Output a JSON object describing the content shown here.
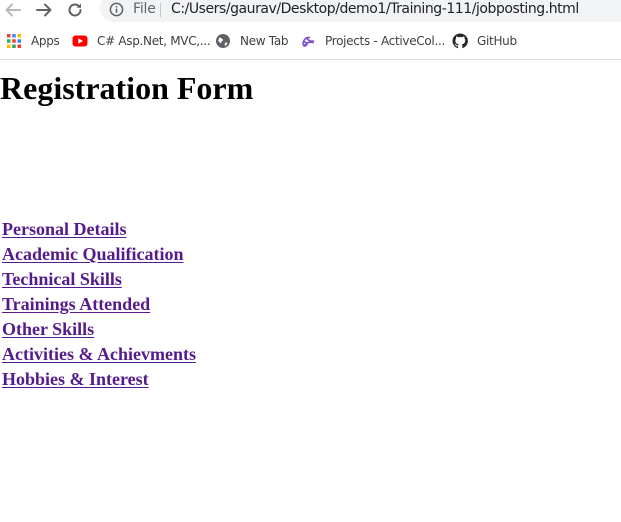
{
  "browser": {
    "scheme_label": "File",
    "url": "C:/Users/gaurav/Desktop/demo1/Training-111/jobposting.html",
    "icons": {
      "back": "arrow-left",
      "forward": "arrow-right",
      "reload": "reload",
      "info": "info-circle"
    }
  },
  "bookmarks": [
    {
      "label": "Apps",
      "icon": "apps-grid-icon"
    },
    {
      "label": "C# Asp.Net, MVC,...",
      "icon": "youtube-icon"
    },
    {
      "label": "New Tab",
      "icon": "globe-icon"
    },
    {
      "label": "Projects - ActiveCol...",
      "icon": "projects-icon"
    },
    {
      "label": "GitHub",
      "icon": "github-icon"
    }
  ],
  "page": {
    "title": "Registration Form",
    "link_color": "#551a8b",
    "links": [
      "Personal Details",
      "Academic Qualification",
      "Technical Skills",
      "Trainings Attended",
      "Other Skills",
      "Activities & Achievments",
      "Hobbies & Interest"
    ]
  }
}
